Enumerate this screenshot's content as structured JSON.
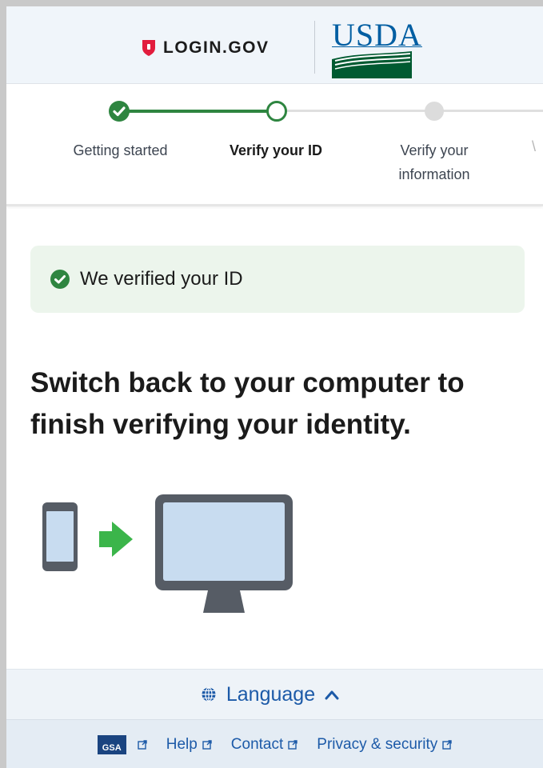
{
  "header": {
    "login_brand": "LOGIN.GOV",
    "partner_brand": "USDA"
  },
  "steps": [
    {
      "label": "Getting started",
      "state": "complete"
    },
    {
      "label": "Verify your ID",
      "state": "current"
    },
    {
      "label": "Verify your information",
      "state": "pending"
    }
  ],
  "alert": {
    "text": "We verified your ID",
    "color": "#2e8540"
  },
  "main": {
    "heading": "Switch back to your computer to finish verifying your identity."
  },
  "footer": {
    "language_label": "Language",
    "gsa_label": "GSA",
    "links": [
      "Help",
      "Contact",
      "Privacy & security"
    ]
  },
  "colors": {
    "success": "#2e8540",
    "link": "#1c5aa8",
    "header_bg": "#f0f5fa",
    "alert_bg": "#ecf5ec"
  },
  "icons": {
    "step_complete": "check-icon",
    "alert": "check-circle-icon",
    "language": "globe-icon",
    "language_toggle": "chevron-up-icon",
    "external": "external-link-icon",
    "illustration": [
      "phone-icon",
      "arrow-right-icon",
      "computer-monitor-icon"
    ]
  }
}
